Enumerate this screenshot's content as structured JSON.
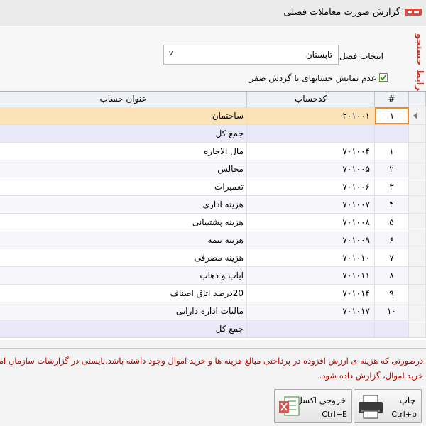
{
  "window": {
    "title": "گزارش صورت معاملات فصلی"
  },
  "search": {
    "side_label": "شرایط جستجو",
    "season_label": "انتخاب فصل :",
    "season_value": "تابستان",
    "checkbox_label": "عدم نمایش حسابهای با گردش صفر",
    "checkbox_checked": true
  },
  "grid": {
    "headers": {
      "num": "#",
      "code": "کدحساب",
      "title": "عنوان حساب"
    },
    "rows": [
      {
        "num": "۱",
        "code": "۲۰۱۰۰۱",
        "title": "ساختمان",
        "kind": "selected"
      },
      {
        "num": "",
        "code": "",
        "title": "جمع کل",
        "kind": "total"
      },
      {
        "num": "۱",
        "code": "۷۰۱۰۰۴",
        "title": "مال الاجاره",
        "kind": "normal"
      },
      {
        "num": "۲",
        "code": "۷۰۱۰۰۵",
        "title": "مجالس",
        "kind": "alt"
      },
      {
        "num": "۳",
        "code": "۷۰۱۰۰۶",
        "title": "تعمیرات",
        "kind": "normal"
      },
      {
        "num": "۴",
        "code": "۷۰۱۰۰۷",
        "title": "هزینه اداری",
        "kind": "alt"
      },
      {
        "num": "۵",
        "code": "۷۰۱۰۰۸",
        "title": "هزینه پشتیبانی",
        "kind": "normal"
      },
      {
        "num": "۶",
        "code": "۷۰۱۰۰۹",
        "title": "هزینه بیمه",
        "kind": "alt"
      },
      {
        "num": "۷",
        "code": "۷۰۱۰۱۰",
        "title": "هزینه مصرفی",
        "kind": "normal"
      },
      {
        "num": "۸",
        "code": "۷۰۱۰۱۱",
        "title": "ایاب و ذهاب",
        "kind": "alt"
      },
      {
        "num": "۹",
        "code": "۷۰۱۰۱۴",
        "title": "20درصد اتاق اصناف",
        "kind": "normal"
      },
      {
        "num": "۱۰",
        "code": "۷۰۱۰۱۷",
        "title": "مالیات اداره دارایی",
        "kind": "alt"
      },
      {
        "num": "",
        "code": "",
        "title": "جمع کل",
        "kind": "total"
      }
    ]
  },
  "note": {
    "line1": "درصورتی که هزینه ی ارزش افزوده در پرداختی مبالغ هزینه ها و خرید اموال وجود داشته باشد.بایستی در گزارشات سازمان امور",
    "line2": "خرید اموال، گزارش داده شود."
  },
  "buttons": {
    "print_label": "چاپ",
    "print_shortcut": "Ctrl+p",
    "excel_label": "خروجی اکسل",
    "excel_shortcut": "Ctrl+E"
  },
  "colors": {
    "accent": "#f08a24",
    "note_text": "#b00000",
    "side_label": "#c0392b"
  }
}
